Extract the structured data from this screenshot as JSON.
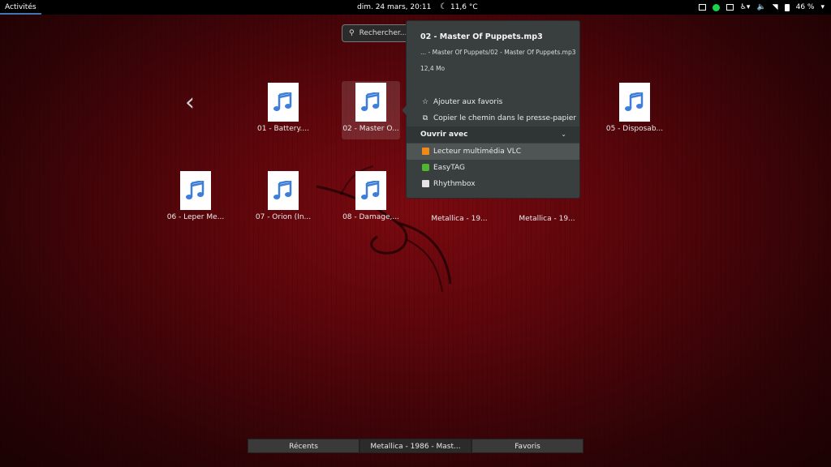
{
  "topbar": {
    "activities": "Activités",
    "clock": "dim. 24 mars, 20:11",
    "weather": "11,6 °C",
    "battery": "46 %"
  },
  "search": {
    "placeholder": "Rechercher..."
  },
  "files": [
    {
      "name": "01 - Battery...."
    },
    {
      "name": "02 - Master O..."
    },
    {
      "name": "05 - Disposab..."
    },
    {
      "name": "06 - Leper Me..."
    },
    {
      "name": "07 - Orion (In..."
    },
    {
      "name": "08 - Damage,..."
    },
    {
      "name": "Metallica - 19..."
    },
    {
      "name": "Metallica - 19..."
    }
  ],
  "popover": {
    "title": "02 - Master Of Puppets.mp3",
    "path": "... - Master Of Puppets/02 - Master Of Puppets.mp3",
    "size": "12,4 Mo",
    "add_bookmark": "Ajouter aux favoris",
    "copy_path": "Copier le chemin dans le presse-papier",
    "open_with": "Ouvrir avec",
    "apps": [
      "Lecteur multimédia VLC",
      "EasyTAG",
      "Rhythmbox"
    ]
  },
  "bottom_tabs": [
    "Récents",
    "Metallica - 1986 - Mast...",
    "Favoris"
  ]
}
